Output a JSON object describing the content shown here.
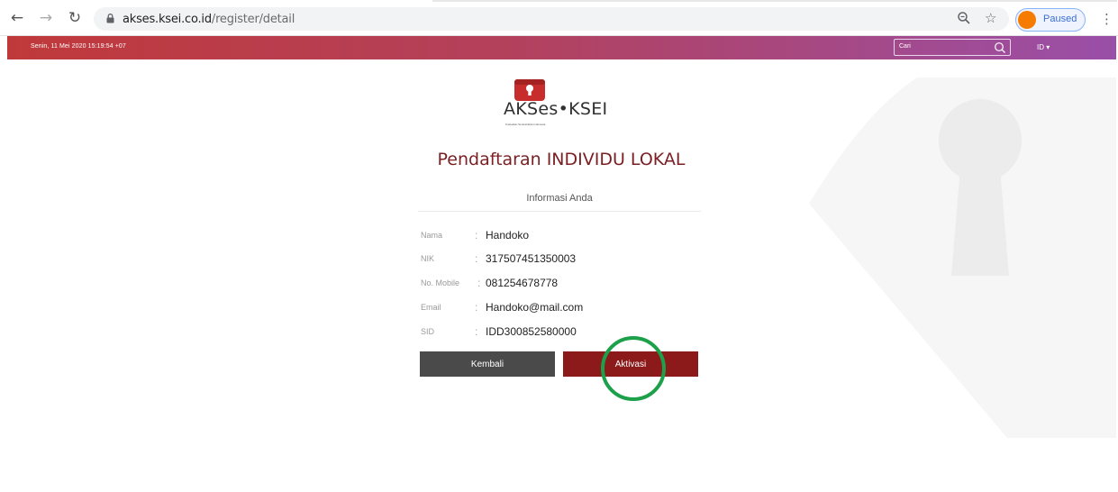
{
  "browser": {
    "url_host": "akses.ksei.co.id",
    "url_path": "/register/detail",
    "profile_label": "Paused"
  },
  "site": {
    "datetime": "Senin, 11 Mei 2020 15:19:54 +07",
    "search_placeholder": "Cari",
    "language": "ID ▾"
  },
  "logo": {
    "brand": "AKSes•KSEI",
    "tagline": "Kustodian Sentral Efek Indonesia"
  },
  "page": {
    "title": "Pendaftaran INDIVIDU LOKAL",
    "subtitle": "Informasi Anda"
  },
  "fields": [
    {
      "label": "Nama",
      "value": "Handoko"
    },
    {
      "label": "NIK",
      "value": "317507451350003"
    },
    {
      "label": "No. Mobile",
      "value": "081254678778"
    },
    {
      "label": "Email",
      "value": "Handoko@mail.com"
    },
    {
      "label": "SID",
      "value": "IDD300852580000"
    }
  ],
  "buttons": {
    "back": "Kembali",
    "activate": "Aktivasi"
  },
  "colors": {
    "header_gradient_start": "#c0393a",
    "header_gradient_end": "#9a4fa8",
    "title": "#7a1f22",
    "activate_button": "#8c1a1a",
    "back_button": "#4a4a4a",
    "highlight_circle": "#1da04a"
  }
}
